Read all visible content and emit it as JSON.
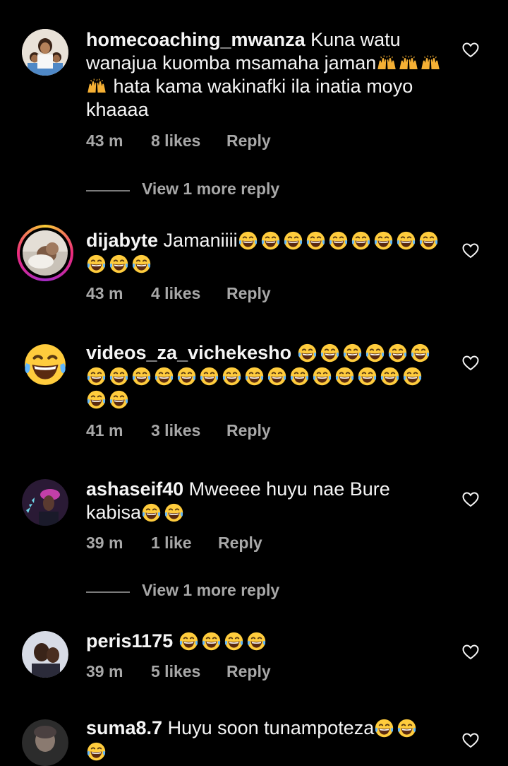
{
  "comments": [
    {
      "username": "homecoaching_mwanza",
      "text_before": "Kuna watu wanajua kuomba msamaha jaman",
      "text_after": " hata kama wakinafki ila inatia moyo khaaaa",
      "emoji_before": "raising-hands x3",
      "emoji_after": "raising-hands x1",
      "time": "43 m",
      "likes": "8 likes",
      "reply": "Reply",
      "view_more": "View 1 more reply"
    },
    {
      "username": "dijabyte",
      "text": "Jamaniiii",
      "emoji": "laughing-tears x12",
      "time": "43 m",
      "likes": "4 likes",
      "reply": "Reply",
      "story_ring": true
    },
    {
      "username": "videos_za_vichekesho",
      "text": "",
      "emoji": "laughing-tears x23",
      "time": "41 m",
      "likes": "3 likes",
      "reply": "Reply"
    },
    {
      "username": "ashaseif40",
      "text": "Mweeee huyu nae Bure kabisa",
      "emoji": "laughing-tears x2",
      "time": "39 m",
      "likes": "1 like",
      "reply": "Reply",
      "view_more": "View 1 more reply"
    },
    {
      "username": "peris1175",
      "text": "",
      "emoji": "laughing-tears x4",
      "time": "39 m",
      "likes": "5 likes",
      "reply": "Reply"
    },
    {
      "username": "suma8.7",
      "text": "Huyu soon tunampoteza",
      "emoji": "laughing-tears x3"
    }
  ],
  "colors": {
    "background": "#000000",
    "text": "#f5f5f5",
    "secondary_text": "#a8a8a8"
  },
  "icons": {
    "like": "heart-outline-icon",
    "emoji_laugh": "face-with-tears-of-joy",
    "emoji_hands": "raising-hands"
  }
}
